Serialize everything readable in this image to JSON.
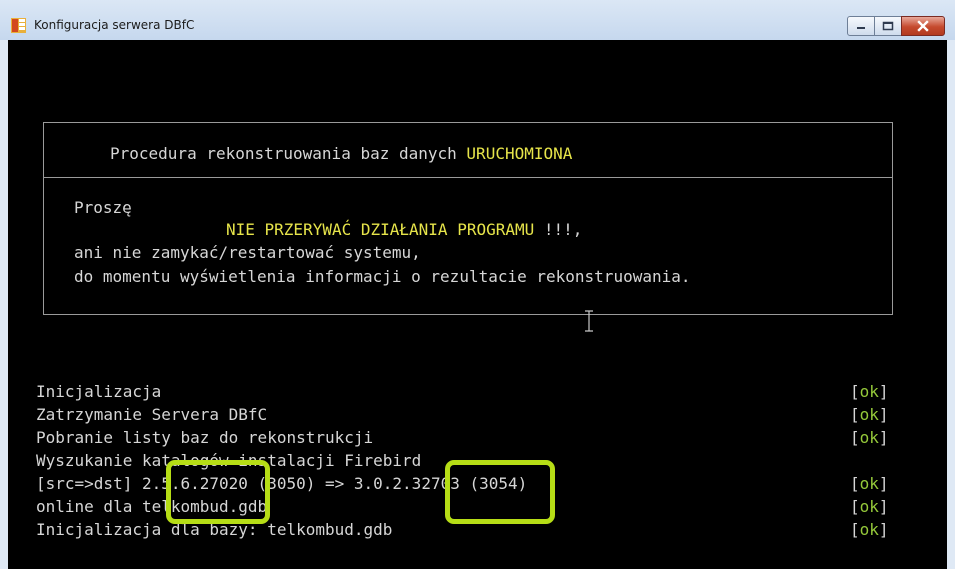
{
  "window": {
    "title": "Konfiguracja serwera DBfC",
    "controls": {
      "minimize": "minimize-icon",
      "maximize": "maximize-icon",
      "close": "close-icon"
    }
  },
  "box": {
    "header_prefix": "Procedura rekonstruowania baz danych ",
    "header_status": "URUCHOMIONA",
    "line1": "Proszę",
    "warning": "NIE PRZERYWAĆ DZIAŁANIA PROGRAMU",
    "warning_suffix": " !!!,",
    "line3": "ani nie zamykać/restartować systemu,",
    "line4": "do momentu wyświetlenia informacji o rezultacie rekonstruowania."
  },
  "log": [
    {
      "text": "Inicjalizacja",
      "status": "ok"
    },
    {
      "text": "Zatrzymanie Servera DBfC",
      "status": "ok"
    },
    {
      "text": "Pobranie listy baz do rekonstrukcji",
      "status": "ok"
    },
    {
      "text": "Wyszukanie katalogów instalacji Firebird",
      "status": ""
    },
    {
      "text": "[src=>dst] 2.5.6.27020 (3050) => 3.0.2.32703 (3054)",
      "status": "ok"
    },
    {
      "text": "online dla telkombud.gdb",
      "status": "ok"
    },
    {
      "text": "Inicjalizacja dla bazy: telkombud.gdb",
      "status": "ok"
    }
  ],
  "colors": {
    "warning": "#e6e44a",
    "ok": "#95c93a",
    "highlight": "#b6dd16",
    "console_bg": "#000000"
  }
}
